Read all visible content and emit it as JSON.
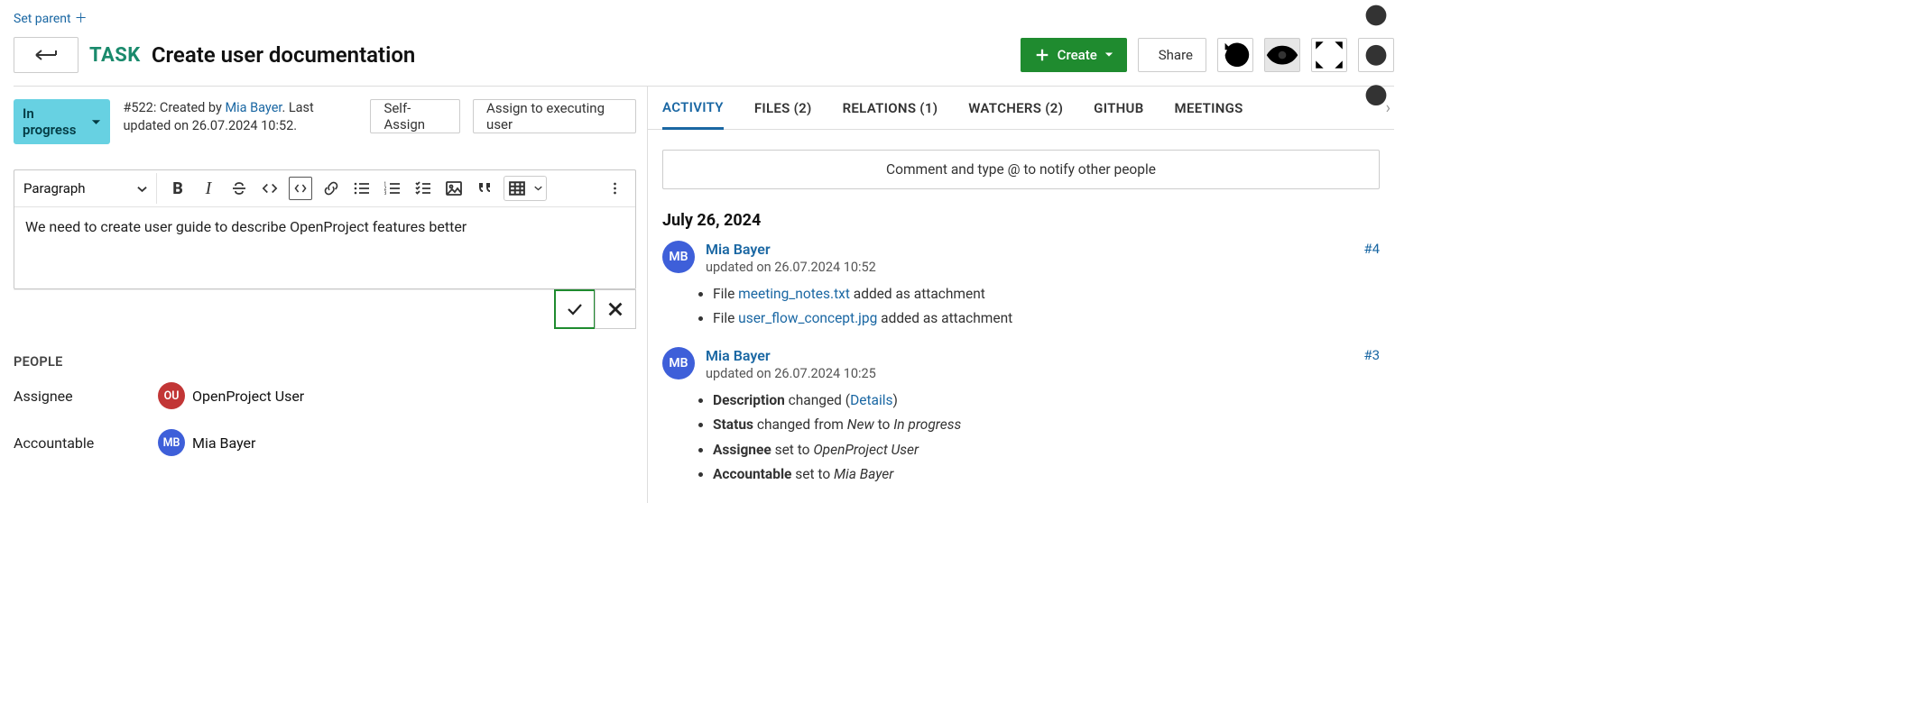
{
  "set_parent": "Set parent",
  "header": {
    "type": "TASK",
    "title": "Create user documentation",
    "create_label": "Create",
    "share_label": "Share"
  },
  "status": {
    "label": "In progress"
  },
  "meta": {
    "id_prefix": "#522: Created by ",
    "creator": "Mia Bayer",
    "suffix": ". Last updated on 26.07.2024 10:52."
  },
  "actions": {
    "self_assign": "Self-Assign",
    "assign_exec": "Assign to executing user"
  },
  "editor": {
    "style_dropdown": "Paragraph",
    "content": "We need to create user guide to describe OpenProject features better"
  },
  "people": {
    "section": "PEOPLE",
    "assignee_label": "Assignee",
    "assignee_initials": "OU",
    "assignee_name": "OpenProject User",
    "accountable_label": "Accountable",
    "accountable_initials": "MB",
    "accountable_name": "Mia Bayer"
  },
  "tabs": {
    "activity": "ACTIVITY",
    "files": "FILES (2)",
    "relations": "RELATIONS (1)",
    "watchers": "WATCHERS (2)",
    "github": "GITHUB",
    "meetings": "MEETINGS"
  },
  "comment_placeholder": "Comment and type @ to notify other people",
  "activity": {
    "date_heading": "July 26, 2024",
    "entries": [
      {
        "initials": "MB",
        "user": "Mia Bayer",
        "time": "updated on 26.07.2024 10:52",
        "ref": "#4",
        "items_html": [
          "File <a class='link' href='#'>meeting_notes.txt</a> added as attachment",
          "File <a class='link' href='#'>user_flow_concept.jpg</a> added as attachment"
        ]
      },
      {
        "initials": "MB",
        "user": "Mia Bayer",
        "time": "updated on 26.07.2024 10:25",
        "ref": "#3",
        "items_html": [
          "<b>Description</b> changed (<a class='link' href='#'>Details</a>)",
          "<b>Status</b> changed from <i>New</i> to <i>In progress</i>",
          "<b>Assignee</b> set to <i>OpenProject User</i>",
          "<b>Accountable</b> set to <i>Mia Bayer</i>"
        ]
      }
    ]
  }
}
